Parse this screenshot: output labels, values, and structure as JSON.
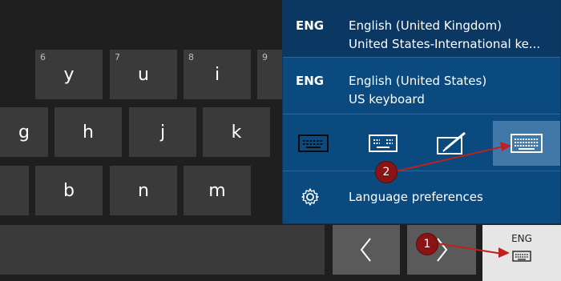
{
  "keyboard": {
    "row1": [
      {
        "hint": "6",
        "char": "y"
      },
      {
        "hint": "7",
        "char": "u"
      },
      {
        "hint": "8",
        "char": "i"
      },
      {
        "hint": "9",
        "char": ""
      }
    ],
    "row2": [
      "g",
      "h",
      "j",
      "k"
    ],
    "row3": [
      "b",
      "n",
      "m"
    ],
    "nav": {
      "prev": "<",
      "next": ">"
    },
    "language_key": {
      "code": "ENG"
    }
  },
  "flyout": {
    "languages": [
      {
        "code": "ENG",
        "name": "English (United Kingdom)",
        "layout": "United States-International ke...",
        "selected": true
      },
      {
        "code": "ENG",
        "name": "English (United States)",
        "layout": "US keyboard",
        "selected": false
      }
    ],
    "keyboard_types": [
      "default-keyboard-icon",
      "small-keyboard-icon",
      "handwriting-icon",
      "full-keyboard-icon"
    ],
    "preferences_label": "Language preferences"
  },
  "annotations": [
    {
      "label": "1"
    },
    {
      "label": "2"
    }
  ],
  "colors": {
    "flyout_bg": "#0b4a7e",
    "highlight": "#3f78a9",
    "annotation": "#c21f1f"
  }
}
